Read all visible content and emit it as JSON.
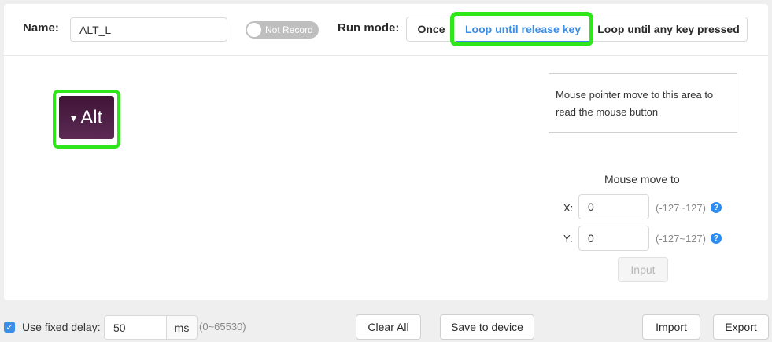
{
  "header": {
    "name_label": "Name:",
    "name_value": "ALT_L",
    "record_toggle": "Not Record",
    "run_mode_label": "Run mode:",
    "modes": [
      "Once",
      "Loop until release key",
      "Loop until any key pressed"
    ],
    "selected_mode": "Loop until release key"
  },
  "key": {
    "caret": "▾",
    "label": "Alt"
  },
  "mouse": {
    "area_text": "Mouse pointer move to this area to read the mouse button",
    "move_title": "Mouse move to",
    "x_label": "X:",
    "x_value": "0",
    "y_label": "Y:",
    "y_value": "0",
    "range": "(-127~127)",
    "help": "?",
    "input_button": "Input"
  },
  "footer": {
    "check_mark": "✓",
    "fixed_delay_checked": true,
    "fixed_delay_label": "Use fixed delay:",
    "delay_value": "50",
    "delay_unit": "ms",
    "delay_range": "(0~65530)",
    "clear_all": "Clear All",
    "save_to_device": "Save to device",
    "import": "Import",
    "export": "Export"
  },
  "colors": {
    "accent": "#3a8ee6",
    "highlight": "#2ee61a",
    "key_bg": "#4a1c44"
  }
}
